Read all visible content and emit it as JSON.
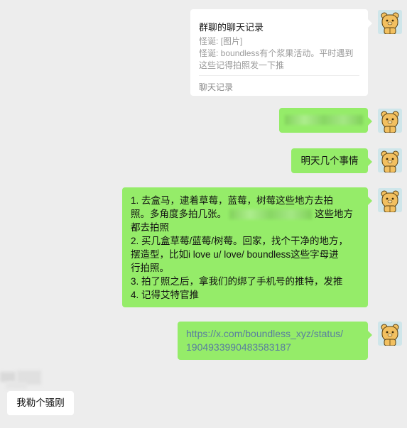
{
  "merged_history": {
    "title": "群聊的聊天记录",
    "line1": "怪诞: [图片]",
    "line2": "怪诞: boundless有个浆果活动。平时遇到这些记得拍照发一下推",
    "footer": "聊天记录"
  },
  "message_short": "明天几个事情",
  "task_list": {
    "l1a": "1. 去盒马，逮着草莓，蓝莓，树莓这些地方去拍",
    "l1b_pre": "照。多角度多拍几张。",
    "l1b_post": "这些地方",
    "l1c": "都去拍照",
    "l2a": "2. 买几盒草莓/蓝莓/树莓。回家，找个干净的地方，",
    "l2b": "摆造型，比如i love u/ love/ boundless这些字母进",
    "l2c": "行拍照。",
    "l3": "3. 拍了照之后，拿我们的绑了手机号的推特，发推",
    "l4": "4. 记得艾特官推"
  },
  "link_message": {
    "line1": "https://x.com/boundless_xyz/status/",
    "line2": "1904933990483583187"
  },
  "incoming": {
    "text": "我勒个骚刚"
  },
  "colors": {
    "chat_bg": "#ededed",
    "own_bubble": "#95ec69",
    "other_bubble": "#ffffff",
    "link": "#5a7e9f"
  },
  "icons": {
    "avatar": "cartoon-bear-avatar"
  }
}
